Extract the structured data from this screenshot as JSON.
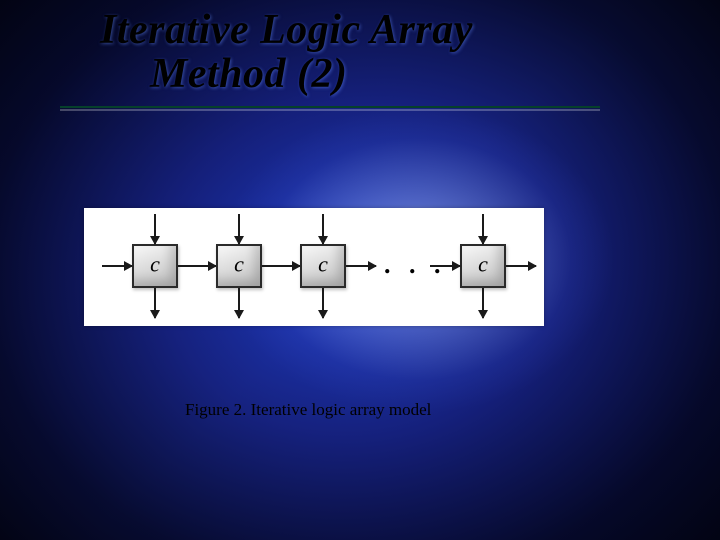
{
  "title_line1": "Iterative Logic Array",
  "title_line2": "Method (2)",
  "caption": "Figure 2. Iterative logic array model",
  "cells": {
    "label": "c"
  },
  "ellipsis": ". . ."
}
